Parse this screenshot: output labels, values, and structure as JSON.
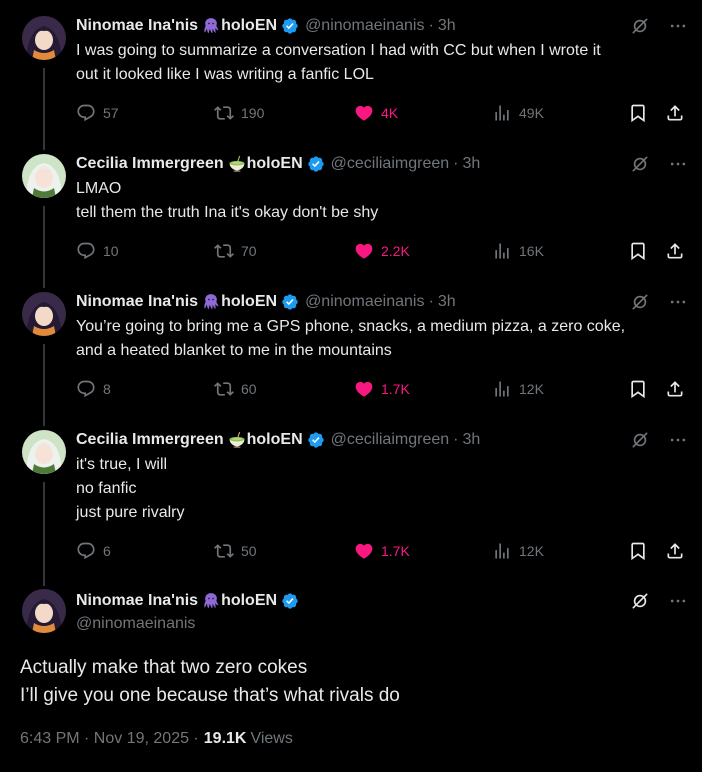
{
  "colors": {
    "background": "#000000",
    "text": "#e7e9ea",
    "secondary": "#71767b",
    "like_pink": "#f91880",
    "verified_blue": "#1d9bf0",
    "thread_line": "#333639"
  },
  "tweets": [
    {
      "name_prefix": "Ninomae Ina'nis",
      "name_emoji": "octopus-emoji",
      "name_suffix": "holoEN",
      "handle": "@ninomaeinanis",
      "time": "3h",
      "lines": [
        "I was going to summarize a conversation I had with CC but when I wrote it",
        "out it looked like I was writing a fanfic LOL"
      ],
      "replies": "57",
      "reposts": "190",
      "likes": "4K",
      "views": "49K"
    },
    {
      "name_prefix": "Cecilia Immergreen",
      "name_emoji": "matcha-bowl-emoji",
      "name_suffix": "holoEN",
      "handle": "@ceciliaimgreen",
      "time": "3h",
      "lines": [
        "LMAO",
        "tell them the truth Ina it's okay don't be shy"
      ],
      "replies": "10",
      "reposts": "70",
      "likes": "2.2K",
      "views": "16K"
    },
    {
      "name_prefix": "Ninomae Ina'nis",
      "name_emoji": "octopus-emoji",
      "name_suffix": "holoEN",
      "handle": "@ninomaeinanis",
      "time": "3h",
      "lines": [
        "You’re going to bring me a GPS phone, snacks, a medium pizza, a zero coke,",
        "and a heated blanket to me in the mountains"
      ],
      "replies": "8",
      "reposts": "60",
      "likes": "1.7K",
      "views": "12K"
    },
    {
      "name_prefix": "Cecilia Immergreen",
      "name_emoji": "matcha-bowl-emoji",
      "name_suffix": "holoEN",
      "handle": "@ceciliaimgreen",
      "time": "3h",
      "lines": [
        "it's true, I will",
        "no fanfic",
        "just pure rivalry"
      ],
      "replies": "6",
      "reposts": "50",
      "likes": "1.7K",
      "views": "12K"
    }
  ],
  "main_tweet": {
    "name_prefix": "Ninomae Ina'nis",
    "name_emoji": "octopus-emoji",
    "name_suffix": "holoEN",
    "handle": "@ninomaeinanis",
    "lines": [
      "Actually make that two zero cokes",
      "I’ll give you one because that’s what rivals do"
    ],
    "timestamp": "6:43 PM · Nov 19, 2025 ·",
    "views_count": "19.1K",
    "views_label": "Views"
  },
  "icons": {
    "reply": "reply-icon",
    "repost": "repost-icon",
    "like": "heart-icon",
    "views": "views-icon",
    "bookmark": "bookmark-icon",
    "share": "share-icon",
    "grok": "grok-icon",
    "more": "more-icon",
    "verified": "verified-badge-icon"
  }
}
